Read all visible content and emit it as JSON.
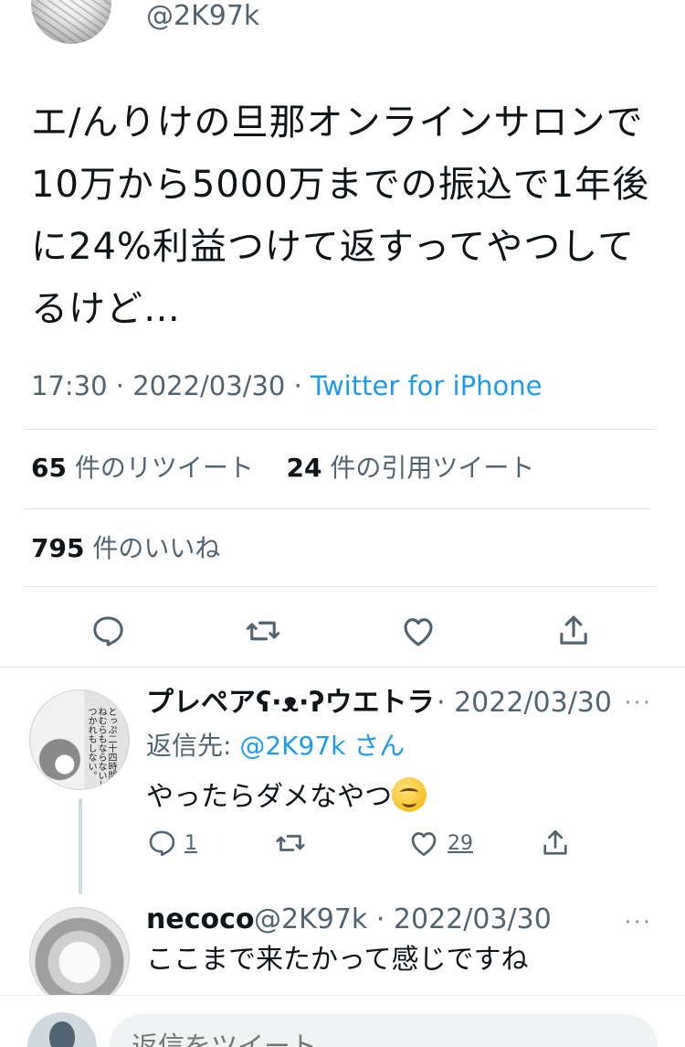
{
  "tweet": {
    "handle": "@2K97k",
    "text": "エ/んりけの旦那オンラインサロンで10万から5000万までの振込で1年後に24%利益つけて返すってやつしてるけど…",
    "time": "17:30",
    "date": "2022/03/30",
    "separator": "·",
    "source": "Twitter for iPhone"
  },
  "stats": {
    "retweet_count": "65",
    "retweet_label": "件のリツイート",
    "quote_count": "24",
    "quote_label": "件の引用ツイート",
    "like_count": "795",
    "like_label": "件のいいね"
  },
  "actions": {
    "reply_icon": "reply-icon",
    "retweet_icon": "retweet-icon",
    "like_icon": "heart-icon",
    "share_icon": "share-icon"
  },
  "replies": [
    {
      "name": "プレペアʕ·ᴥ·ʔウエトラ",
      "meta": "· 2022/03/30",
      "more": "···",
      "reply_to_prefix": "返信先:",
      "reply_to_mention": "@2K97k",
      "reply_to_suffix": "さん",
      "text": "やったらダメなやつ",
      "reply_count": "1",
      "like_count": "29",
      "avatar_text": "とっぷ二十四時間!ねむらもならないしつかれもしない。"
    },
    {
      "name": "necoco",
      "meta": "@2K97k · 2022/03/30",
      "more": "···",
      "text": "ここまで来たかって感じですね"
    }
  ],
  "compose": {
    "placeholder": "返信をツイート"
  },
  "colors": {
    "link": "#1d9bf0",
    "secondary_text": "#536471",
    "divider": "#dde1e4"
  }
}
